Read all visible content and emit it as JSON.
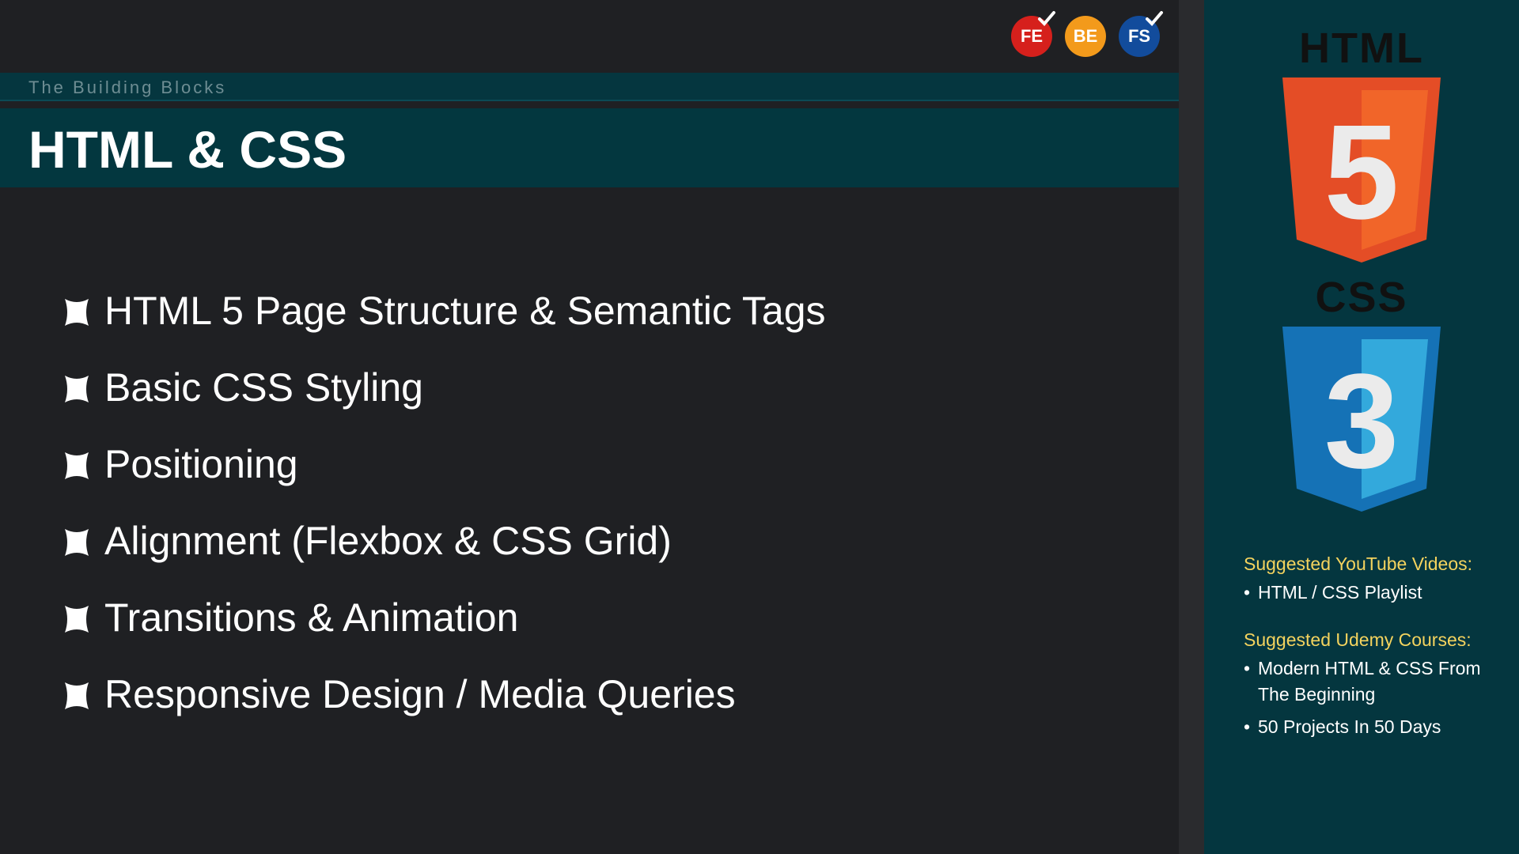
{
  "header": {
    "subheader": "The Building Blocks",
    "title": "HTML & CSS"
  },
  "badges": [
    {
      "label": "FE",
      "color": "#d6201c",
      "checked": true
    },
    {
      "label": "BE",
      "color": "#f39a1b",
      "checked": false
    },
    {
      "label": "FS",
      "color": "#124c9c",
      "checked": true
    }
  ],
  "topics": [
    {
      "label": "HTML 5 Page Structure & Semantic Tags",
      "icon": "puzzle-icon"
    },
    {
      "label": "Basic CSS Styling",
      "icon": "puzzle-icon"
    },
    {
      "label": "Positioning",
      "icon": "puzzle-icon"
    },
    {
      "label": "Alignment (Flexbox & CSS Grid)",
      "icon": "puzzle-icon"
    },
    {
      "label": "Transitions & Animation",
      "icon": "puzzle-icon"
    },
    {
      "label": "Responsive Design / Media Queries",
      "icon": "puzzle-icon"
    }
  ],
  "sidebar": {
    "html_logo_word": "HTML",
    "html_logo_number": "5",
    "css_logo_word": "CSS",
    "css_logo_number": "3",
    "youtube_heading": "Suggested YouTube Videos:",
    "youtube_items": [
      "HTML / CSS Playlist"
    ],
    "udemy_heading": "Suggested Udemy Courses:",
    "udemy_items": [
      "Modern HTML & CSS From The Beginning",
      "50 Projects In 50 Days"
    ]
  },
  "colors": {
    "background": "#1f2023",
    "header_teal": "#03373f",
    "sidebar_teal": "#04363f",
    "accent_yellow": "#f4d35e",
    "html_orange": "#e44d26",
    "css_blue": "#1572b6"
  }
}
